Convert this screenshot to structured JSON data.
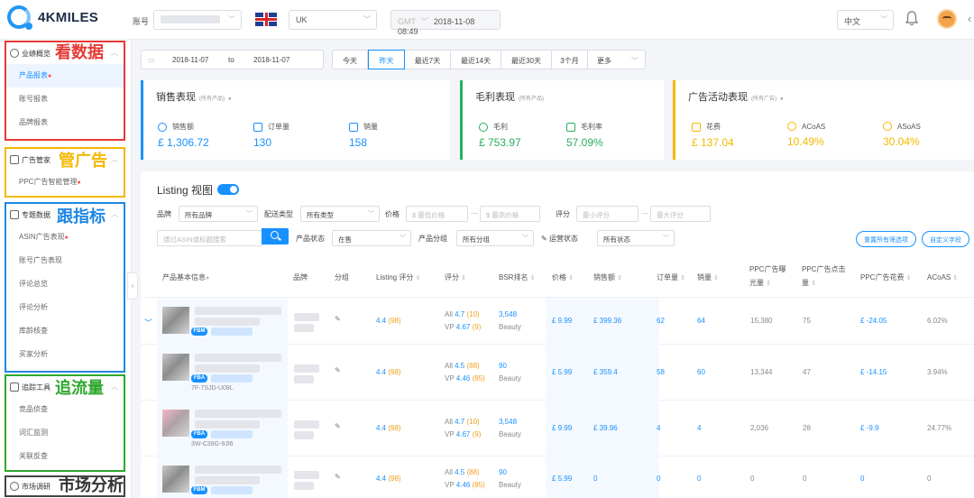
{
  "app": {
    "logo_text": "4KMILES"
  },
  "topbar": {
    "account_label": "账号",
    "marketplace": "UK",
    "timezone": "GMT",
    "datetime": "2018-11-08 08:49",
    "language": "中文",
    "flag": "uk-flag"
  },
  "sidebar": {
    "groups": [
      {
        "title": "业绩概览",
        "tag": "看数据",
        "tag_color": "#e53935",
        "border_color": "#e53935",
        "items": [
          {
            "label": "产品报表",
            "hot": true,
            "active": true
          },
          {
            "label": "账号报表"
          },
          {
            "label": "品牌报表"
          }
        ]
      },
      {
        "title": "广告管家",
        "tag": "管广告",
        "tag_color": "#f5b800",
        "border_color": "#f5b800",
        "items": [
          {
            "label": "PPC广告智能管理",
            "hot": true
          }
        ]
      },
      {
        "title": "专题数据",
        "tag": "跟指标",
        "tag_color": "#1e88e5",
        "border_color": "#1e88e5",
        "items": [
          {
            "label": "ASIN广告表现",
            "hot": true
          },
          {
            "label": "账号广告表现"
          },
          {
            "label": "评论总览"
          },
          {
            "label": "评论分析"
          },
          {
            "label": "库龄核查"
          },
          {
            "label": "买家分析"
          }
        ]
      },
      {
        "title": "追踪工具",
        "tag": "追流量",
        "tag_color": "#2ea82e",
        "border_color": "#2ea82e",
        "items": [
          {
            "label": "竞品侦查"
          },
          {
            "label": "词汇监测"
          },
          {
            "label": "关联反查"
          }
        ]
      },
      {
        "title": "市场调研",
        "tag": "市场分析",
        "tag_color": "#333333",
        "border_color": "#444444",
        "items": []
      }
    ]
  },
  "datebar": {
    "start": "2018-11-07",
    "to": "to",
    "end": "2018-11-07",
    "quick": [
      "今天",
      "昨天",
      "最近7天",
      "最近14天",
      "最近30天",
      "3个月",
      "更多"
    ],
    "active_index": 1
  },
  "cards": {
    "sales": {
      "title": "销售表现",
      "scope": "(所有产品)",
      "accent": "#1890ff",
      "metrics": [
        {
          "label": "销售额",
          "value": "£ 1,306.72"
        },
        {
          "label": "订单量",
          "value": "130"
        },
        {
          "label": "销量",
          "value": "158"
        }
      ]
    },
    "profit": {
      "title": "毛利表现",
      "scope": "(所有产品)",
      "accent": "#27ae60",
      "metrics": [
        {
          "label": "毛利",
          "value": "£ 753.97"
        },
        {
          "label": "毛利率",
          "value": "57.09%"
        }
      ]
    },
    "ads": {
      "title": "广告活动表现",
      "scope": "(所有广告)",
      "accent": "#f5b800",
      "metrics": [
        {
          "label": "花费",
          "value": "£ 137.04"
        },
        {
          "label": "ACoAS",
          "value": "10.49%"
        },
        {
          "label": "ASoAS",
          "value": "30.04%"
        }
      ]
    }
  },
  "listing": {
    "title": "Listing 视图",
    "filters": {
      "brand_label": "品牌",
      "brand_value": "所有品牌",
      "ship_label": "配送类型",
      "ship_value": "所有类型",
      "price_label": "价格",
      "price_min_ph": "最低价格",
      "price_max_ph": "最高价格",
      "rating_label": "评分",
      "rating_min_ph": "最小评分",
      "rating_max_ph": "最大评分",
      "search_ph": "通过ASIN或标题搜索",
      "status_label": "产品状态",
      "status_value": "在售",
      "group_label": "产品分组",
      "group_value": "所有分组",
      "ops_label": "运营状态",
      "ops_value": "所有状态",
      "reset": "重置所有筛选项",
      "custom": "自定义字段"
    },
    "columns": {
      "product": "产品基本信息",
      "brand": "品牌",
      "group": "分组",
      "listing_score": "Listing 评分",
      "rating": "评分",
      "bsr": "BSR排名",
      "price": "价格",
      "sales": "销售额",
      "orders": "订单量",
      "units": "销量",
      "impressions_1": "PPC广告曝",
      "impressions_2": "光量",
      "clicks_1": "PPC广告点击",
      "clicks_2": "量",
      "spend": "PPC广告花费",
      "acoas": "ACoAS"
    },
    "rows": [
      {
        "fulfil": "FBM",
        "sku": "",
        "listing_score": "4.4",
        "listing_count": "(98)",
        "all_rating": "4.7",
        "all_count": "(10)",
        "vp_rating": "4.67",
        "vp_count": "(9)",
        "bsr": "3,548",
        "category": "Beauty",
        "price": "£ 9.99",
        "sales": "£ 399.36",
        "orders": "62",
        "units": "64",
        "impressions": "15,380",
        "clicks": "75",
        "spend": "£ -24.05",
        "acoas": "6.02%"
      },
      {
        "fulfil": "FBA",
        "sku": "7F-7SJD-U08L",
        "listing_score": "4.4",
        "listing_count": "(98)",
        "all_rating": "4.5",
        "all_count": "(88)",
        "vp_rating": "4.46",
        "vp_count": "(85)",
        "bsr": "90",
        "category": "Beauty",
        "price": "£ 5.99",
        "sales": "£ 359.4",
        "orders": "58",
        "units": "60",
        "impressions": "13,344",
        "clicks": "47",
        "spend": "£ -14.15",
        "acoas": "3.94%"
      },
      {
        "fulfil": "FBA",
        "sku": "3W-C39G-9JI6",
        "listing_score": "4.4",
        "listing_count": "(98)",
        "all_rating": "4.7",
        "all_count": "(10)",
        "vp_rating": "4.67",
        "vp_count": "(9)",
        "bsr": "3,548",
        "category": "Beauty",
        "price": "£ 9.99",
        "sales": "£ 39.96",
        "orders": "4",
        "units": "4",
        "impressions": "2,036",
        "clicks": "28",
        "spend": "£ -9.9",
        "acoas": "24.77%"
      },
      {
        "fulfil": "FBM",
        "sku": "",
        "listing_score": "4.4",
        "listing_count": "(98)",
        "all_rating": "4.5",
        "all_count": "(88)",
        "vp_rating": "4.46",
        "vp_count": "(85)",
        "bsr": "90",
        "category": "Beauty",
        "price": "£ 5.99",
        "sales": "0",
        "orders": "0",
        "units": "0",
        "impressions": "0",
        "clicks": "0",
        "spend": "0",
        "acoas": "0"
      }
    ],
    "labels": {
      "all": "All",
      "vp": "VP"
    }
  }
}
